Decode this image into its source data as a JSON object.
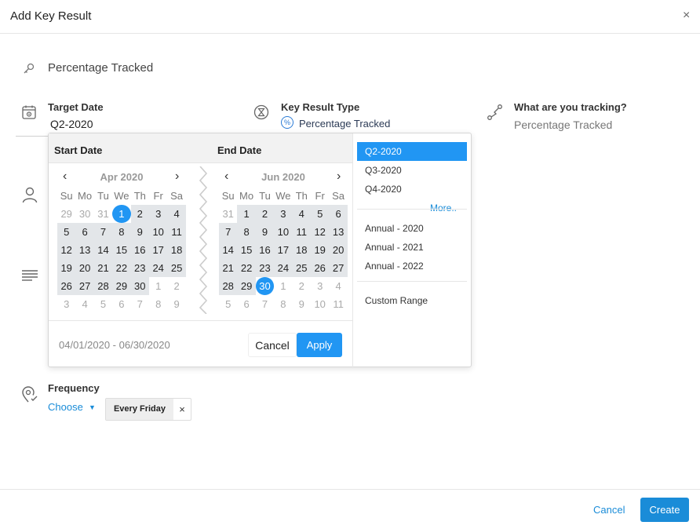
{
  "header": {
    "title": "Add Key Result",
    "close": "×"
  },
  "key_result_name": "Percentage Tracked",
  "target_date": {
    "label": "Target Date",
    "value": "Q2-2020"
  },
  "kr_type": {
    "label": "Key Result Type",
    "badge": "%",
    "value": "Percentage Tracked"
  },
  "tracking": {
    "label": "What are you tracking?",
    "value": "Percentage Tracked"
  },
  "frequency": {
    "label": "Frequency",
    "choose": "Choose",
    "tag": "Every Friday",
    "tag_remove": "×"
  },
  "footer": {
    "cancel": "Cancel",
    "create": "Create"
  },
  "picker": {
    "start_label": "Start Date",
    "end_label": "End Date",
    "prev": "‹",
    "next": "›",
    "range_text": "04/01/2020 - 06/30/2020",
    "cancel": "Cancel",
    "apply": "Apply",
    "dow": [
      "Su",
      "Mo",
      "Tu",
      "We",
      "Th",
      "Fr",
      "Sa"
    ],
    "start_cal": {
      "month": "Apr 2020",
      "weeks": [
        [
          "29",
          "30",
          "31",
          "1",
          "2",
          "3",
          "4"
        ],
        [
          "5",
          "6",
          "7",
          "8",
          "9",
          "10",
          "11"
        ],
        [
          "12",
          "13",
          "14",
          "15",
          "16",
          "17",
          "18"
        ],
        [
          "19",
          "20",
          "21",
          "22",
          "23",
          "24",
          "25"
        ],
        [
          "26",
          "27",
          "28",
          "29",
          "30",
          "1",
          "2"
        ],
        [
          "3",
          "4",
          "5",
          "6",
          "7",
          "8",
          "9"
        ]
      ],
      "first_in_month_index": 3,
      "last_in_month_index": 32,
      "selected_index": 3
    },
    "end_cal": {
      "month": "Jun 2020",
      "weeks": [
        [
          "31",
          "1",
          "2",
          "3",
          "4",
          "5",
          "6"
        ],
        [
          "7",
          "8",
          "9",
          "10",
          "11",
          "12",
          "13"
        ],
        [
          "14",
          "15",
          "16",
          "17",
          "18",
          "19",
          "20"
        ],
        [
          "21",
          "22",
          "23",
          "24",
          "25",
          "26",
          "27"
        ],
        [
          "28",
          "29",
          "30",
          "1",
          "2",
          "3",
          "4"
        ],
        [
          "5",
          "6",
          "7",
          "8",
          "9",
          "10",
          "11"
        ]
      ],
      "first_in_month_index": 1,
      "last_in_month_index": 30,
      "selected_index": 30
    },
    "presets_quarters": [
      "Q2-2020",
      "Q3-2020",
      "Q4-2020"
    ],
    "more": "More..",
    "presets_annual": [
      "Annual - 2020",
      "Annual - 2021",
      "Annual - 2022"
    ],
    "custom": "Custom Range",
    "active_preset": "Q2-2020"
  },
  "colors": {
    "accent": "#2196f3",
    "link": "#1a8cd8",
    "range_bg": "#e3e6e9"
  }
}
